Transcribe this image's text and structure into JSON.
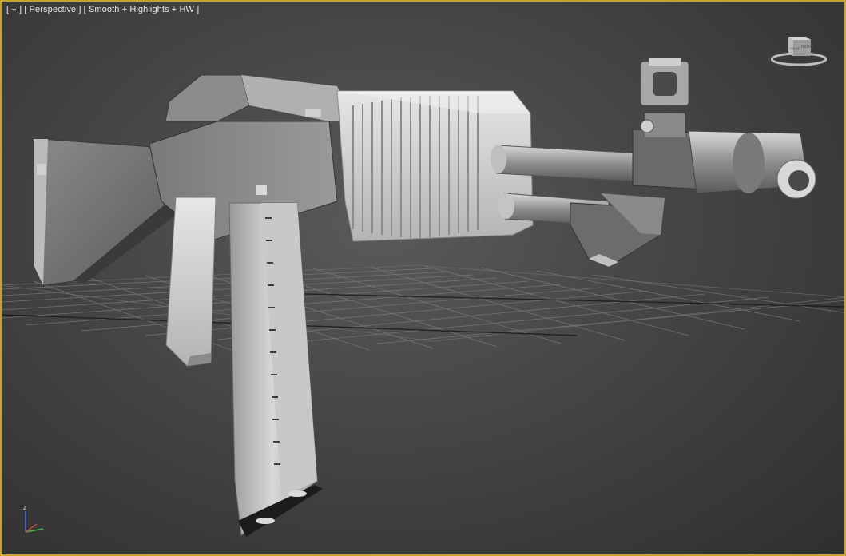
{
  "viewport": {
    "menu_plus": "[ + ]",
    "view_mode": "[ Perspective ]",
    "shading_mode": "[ Smooth + Highlights + HW ]",
    "border_color": "#c9a227"
  },
  "viewcube": {
    "icon": "viewcube-icon",
    "face_labels": [
      "FRONT",
      "RIGHT"
    ]
  },
  "axis": {
    "icon": "axis-tripod-icon",
    "z_label": "z"
  },
  "scene": {
    "object": "rifle-model",
    "grid": true
  }
}
